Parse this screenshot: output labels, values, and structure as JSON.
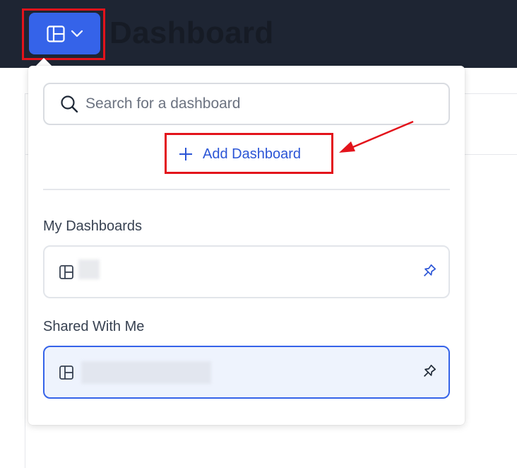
{
  "header": {
    "title": "Dashboard",
    "switcher_icon": "dashboard-layout-icon",
    "switcher_chevron_icon": "chevron-down-icon"
  },
  "dropdown": {
    "search": {
      "placeholder": "Search for a dashboard",
      "value": "",
      "icon": "search-icon"
    },
    "add_button": {
      "label": "Add Dashboard",
      "icon": "plus-icon"
    },
    "sections": [
      {
        "label": "My Dashboards",
        "items": [
          {
            "name": "",
            "icon": "dashboard-layout-icon",
            "pin_icon": "pin-icon",
            "pinned": false
          }
        ]
      },
      {
        "label": "Shared With Me",
        "items": [
          {
            "name": "",
            "icon": "dashboard-layout-icon",
            "pin_icon": "pin-icon",
            "pinned": false,
            "selected": true
          }
        ]
      }
    ]
  },
  "colors": {
    "header_bg": "#1e2533",
    "accent": "#3563e9",
    "link": "#2b55d6",
    "annotation": "#e3131b",
    "selected_bg": "#eef3fd"
  }
}
